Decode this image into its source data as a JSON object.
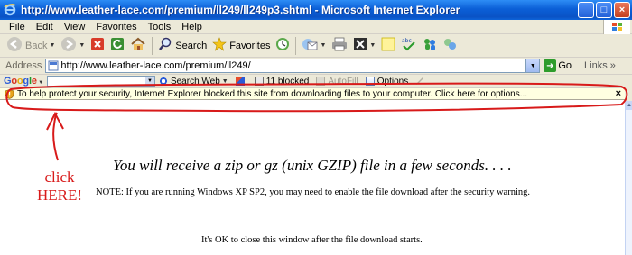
{
  "window": {
    "title": "http://www.leather-lace.com/premium/ll249/ll249p3.shtml - Microsoft Internet Explorer",
    "buttons": [
      "_",
      "□",
      "×"
    ]
  },
  "menu": {
    "items": [
      "File",
      "Edit",
      "View",
      "Favorites",
      "Tools",
      "Help"
    ]
  },
  "toolbar": {
    "back_label": "Back",
    "search_label": "Search",
    "favorites_label": "Favorites"
  },
  "address": {
    "label": "Address",
    "url": "http://www.leather-lace.com/premium/ll249/",
    "go_label": "Go",
    "links_label": "Links"
  },
  "google_toolbar": {
    "logo": "Google",
    "search_web_label": "Search Web",
    "blocked_label": "11 blocked",
    "autofill_label": "AutoFill",
    "options_label": "Options"
  },
  "infobar": {
    "text": "To help protect your security, Internet Explorer blocked this site from downloading files to your computer. Click here for options...",
    "close": "×"
  },
  "page": {
    "heading": "You will receive a zip or gz (unix GZIP) file in a few seconds. . . .",
    "note": "NOTE: If you are running Windows XP SP2, you may need to enable the file download after the security warning.",
    "ok_close": "It's OK to close this window after the file download starts."
  },
  "annotation": {
    "line1": "click",
    "line2": "HERE!",
    "color": "#d81a1a"
  }
}
